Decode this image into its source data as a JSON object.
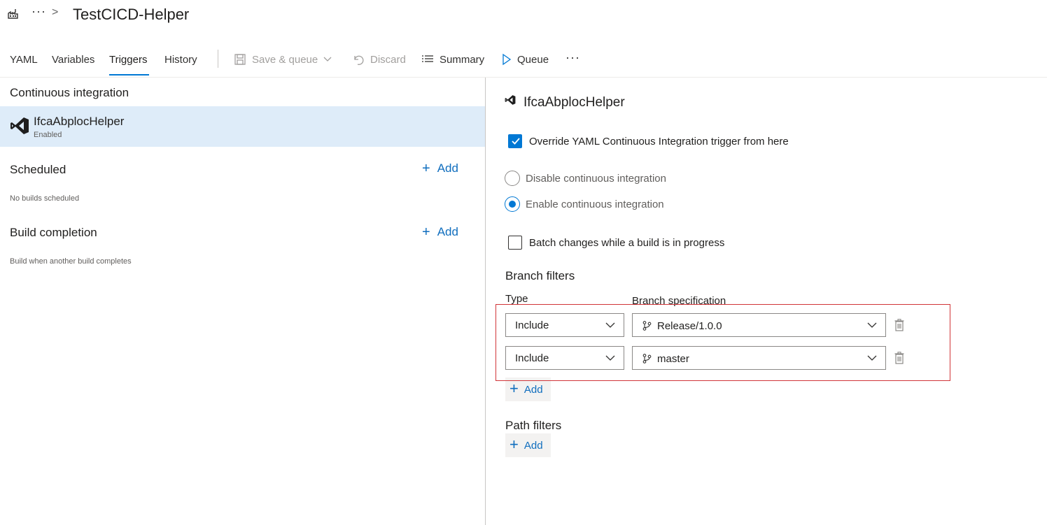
{
  "header": {
    "more": "···",
    "separator": ">",
    "title": "TestCICD-Helper"
  },
  "tabs": [
    {
      "label": "YAML"
    },
    {
      "label": "Variables"
    },
    {
      "label": "Triggers",
      "active": true
    },
    {
      "label": "History"
    }
  ],
  "toolbar": {
    "save_queue": "Save & queue",
    "discard": "Discard",
    "summary": "Summary",
    "queue": "Queue",
    "more": "···"
  },
  "left": {
    "ci_section": "Continuous integration",
    "ci_item": {
      "name": "IfcaAbplocHelper",
      "status": "Enabled",
      "icon": "visual-studio-icon"
    },
    "scheduled": {
      "title": "Scheduled",
      "add": "Add",
      "empty": "No builds scheduled"
    },
    "build_completion": {
      "title": "Build completion",
      "add": "Add",
      "empty": "Build when another build completes"
    }
  },
  "right": {
    "title": "IfcaAbplocHelper",
    "override_label": "Override YAML Continuous Integration trigger from here",
    "override_checked": true,
    "radio_disable": "Disable continuous integration",
    "radio_enable": "Enable continuous integration",
    "selected_radio": "enable",
    "batch_label": "Batch changes while a build is in progress",
    "batch_checked": false,
    "branch_filters": {
      "title": "Branch filters",
      "type_header": "Type",
      "spec_header": "Branch specification",
      "rows": [
        {
          "type": "Include",
          "branch": "Release/1.0.0"
        },
        {
          "type": "Include",
          "branch": "master"
        }
      ],
      "add": "Add"
    },
    "path_filters": {
      "title": "Path filters",
      "add": "Add"
    }
  },
  "colors": {
    "accent": "#0078d4",
    "selected_row": "#deecf9",
    "highlight_border": "#d13438"
  }
}
